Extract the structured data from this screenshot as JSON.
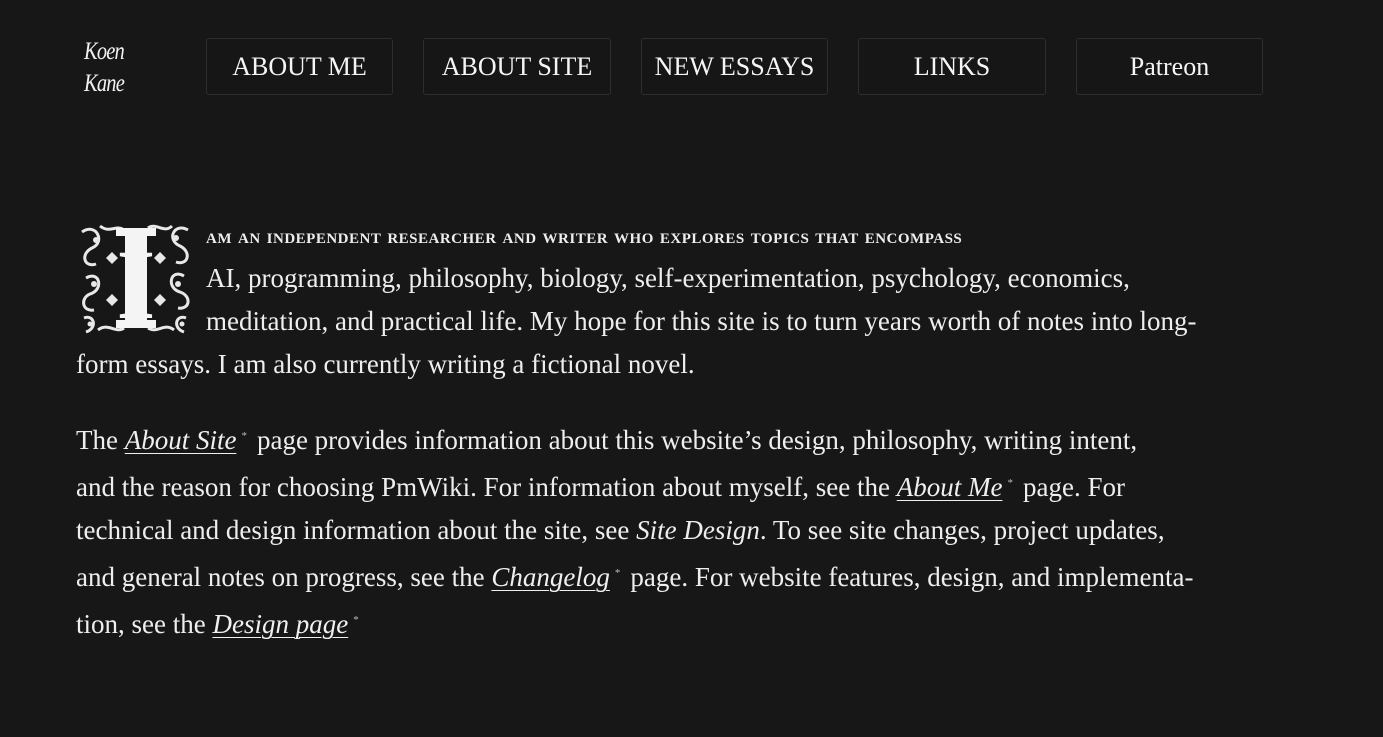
{
  "logo": {
    "line1": "Koen",
    "line2": "Kane"
  },
  "nav": [
    {
      "label": "ABOUT ME"
    },
    {
      "label": "ABOUT SITE"
    },
    {
      "label": "NEW ESSAYS"
    },
    {
      "label": "LINKS"
    },
    {
      "label": "Patreon"
    }
  ],
  "intro": {
    "dropcap": "I",
    "line1": "am an independent researcher and writer who explores topics that encompass",
    "line2": "AI, programming, philosophy, biology, self-experimentation, psychology, economics,",
    "line3": "meditation, and practical life. My hope for this site is to turn years worth of notes into long-",
    "line4": "form essays. I am also currently writing a fictional novel."
  },
  "para2": {
    "l1_pre": "The",
    "l1_link": "About Site",
    "l1_post": "page provides information about this website’s design, philosophy, writing intent,",
    "l2_pre": "and the reason for choosing PmWiki. For information about myself, see the",
    "l2_link": "About Me",
    "l2_post": "page. For",
    "l3_pre": "technical and design information about the site, see",
    "l3_italic": "Site Design",
    "l3_post": ". To see site changes, project updates,",
    "l4_pre": "and general notes on progress, see the",
    "l4_link": "Changelog",
    "l4_post": "page. For website features, design, and implementa-",
    "l5_pre": "tion, see the",
    "l5_link": "Design page",
    "link_mark": "*"
  }
}
